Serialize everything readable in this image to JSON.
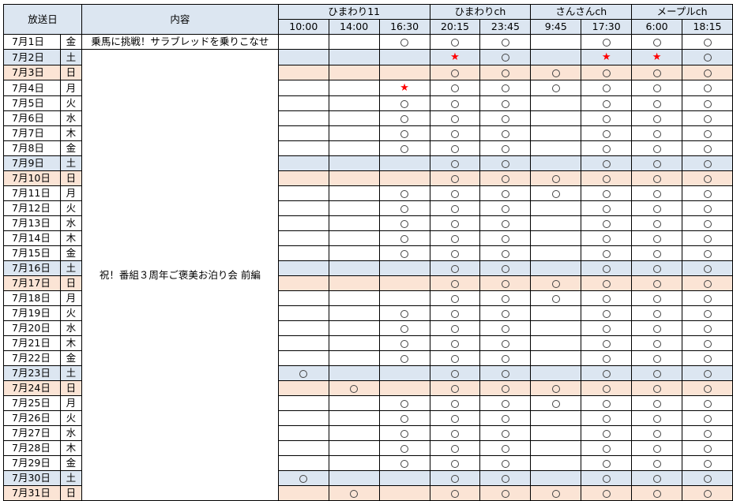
{
  "header": {
    "date_label": "放送日",
    "content_label": "内容",
    "channels": [
      {
        "name": "ひまわり11",
        "span": 3
      },
      {
        "name": "ひまわりch",
        "span": 2
      },
      {
        "name": "さんさんch",
        "span": 2
      },
      {
        "name": "メープルch",
        "span": 2
      }
    ],
    "times": [
      "10:00",
      "14:00",
      "16:30",
      "20:15",
      "23:45",
      "9:45",
      "17:30",
      "6:00",
      "18:15"
    ]
  },
  "contents": [
    {
      "text": "乗馬に挑戦！サラブレッドを乗りこなせ",
      "rows": 1
    },
    {
      "text": "祝！番組３周年ご褒美お泊り会  前編",
      "rows": 30
    }
  ],
  "marks": {
    "circle": "○",
    "star": "★"
  },
  "rows": [
    {
      "date": "7月1日",
      "day": "金",
      "type": "weekday",
      "marks": [
        "",
        "",
        "○",
        "○",
        "○",
        "",
        "○",
        "○",
        "○"
      ]
    },
    {
      "date": "7月2日",
      "day": "土",
      "type": "sat",
      "marks": [
        "",
        "",
        "",
        "★",
        "○",
        "",
        "★",
        "★",
        "○"
      ]
    },
    {
      "date": "7月3日",
      "day": "日",
      "type": "sun",
      "marks": [
        "",
        "",
        "",
        "○",
        "○",
        "○",
        "○",
        "○",
        "○"
      ]
    },
    {
      "date": "7月4日",
      "day": "月",
      "type": "weekday",
      "marks": [
        "",
        "",
        "★",
        "○",
        "○",
        "○",
        "○",
        "○",
        "○"
      ]
    },
    {
      "date": "7月5日",
      "day": "火",
      "type": "weekday",
      "marks": [
        "",
        "",
        "○",
        "○",
        "○",
        "",
        "○",
        "○",
        "○"
      ]
    },
    {
      "date": "7月6日",
      "day": "水",
      "type": "weekday",
      "marks": [
        "",
        "",
        "○",
        "○",
        "○",
        "",
        "○",
        "○",
        "○"
      ]
    },
    {
      "date": "7月7日",
      "day": "木",
      "type": "weekday",
      "marks": [
        "",
        "",
        "○",
        "○",
        "○",
        "",
        "○",
        "○",
        "○"
      ]
    },
    {
      "date": "7月8日",
      "day": "金",
      "type": "weekday",
      "marks": [
        "",
        "",
        "○",
        "○",
        "○",
        "",
        "○",
        "○",
        "○"
      ]
    },
    {
      "date": "7月9日",
      "day": "土",
      "type": "sat",
      "marks": [
        "",
        "",
        "",
        "○",
        "○",
        "",
        "○",
        "○",
        "○"
      ]
    },
    {
      "date": "7月10日",
      "day": "日",
      "type": "sun",
      "marks": [
        "",
        "",
        "",
        "○",
        "○",
        "○",
        "○",
        "○",
        "○"
      ]
    },
    {
      "date": "7月11日",
      "day": "月",
      "type": "weekday",
      "marks": [
        "",
        "",
        "○",
        "○",
        "○",
        "○",
        "○",
        "○",
        "○"
      ]
    },
    {
      "date": "7月12日",
      "day": "火",
      "type": "weekday",
      "marks": [
        "",
        "",
        "○",
        "○",
        "○",
        "",
        "○",
        "○",
        "○"
      ]
    },
    {
      "date": "7月13日",
      "day": "水",
      "type": "weekday",
      "marks": [
        "",
        "",
        "○",
        "○",
        "○",
        "",
        "○",
        "○",
        "○"
      ]
    },
    {
      "date": "7月14日",
      "day": "木",
      "type": "weekday",
      "marks": [
        "",
        "",
        "○",
        "○",
        "○",
        "",
        "○",
        "○",
        "○"
      ]
    },
    {
      "date": "7月15日",
      "day": "金",
      "type": "weekday",
      "marks": [
        "",
        "",
        "○",
        "○",
        "○",
        "",
        "○",
        "○",
        "○"
      ]
    },
    {
      "date": "7月16日",
      "day": "土",
      "type": "sat",
      "marks": [
        "",
        "",
        "",
        "○",
        "○",
        "",
        "○",
        "○",
        "○"
      ]
    },
    {
      "date": "7月17日",
      "day": "日",
      "type": "sun",
      "marks": [
        "",
        "",
        "",
        "○",
        "○",
        "○",
        "○",
        "○",
        "○"
      ]
    },
    {
      "date": "7月18日",
      "day": "月",
      "type": "weekday",
      "marks": [
        "",
        "",
        "",
        "○",
        "○",
        "○",
        "○",
        "○",
        "○"
      ]
    },
    {
      "date": "7月19日",
      "day": "火",
      "type": "weekday",
      "marks": [
        "",
        "",
        "○",
        "○",
        "○",
        "",
        "○",
        "○",
        "○"
      ]
    },
    {
      "date": "7月20日",
      "day": "水",
      "type": "weekday",
      "marks": [
        "",
        "",
        "○",
        "○",
        "○",
        "",
        "○",
        "○",
        "○"
      ]
    },
    {
      "date": "7月21日",
      "day": "木",
      "type": "weekday",
      "marks": [
        "",
        "",
        "○",
        "○",
        "○",
        "",
        "○",
        "○",
        "○"
      ]
    },
    {
      "date": "7月22日",
      "day": "金",
      "type": "weekday",
      "marks": [
        "",
        "",
        "○",
        "○",
        "○",
        "",
        "○",
        "○",
        "○"
      ]
    },
    {
      "date": "7月23日",
      "day": "土",
      "type": "sat",
      "marks": [
        "○",
        "",
        "",
        "○",
        "○",
        "",
        "○",
        "○",
        "○"
      ]
    },
    {
      "date": "7月24日",
      "day": "日",
      "type": "sun",
      "marks": [
        "",
        "○",
        "",
        "○",
        "○",
        "○",
        "○",
        "○",
        "○"
      ]
    },
    {
      "date": "7月25日",
      "day": "月",
      "type": "weekday",
      "marks": [
        "",
        "",
        "○",
        "○",
        "○",
        "○",
        "○",
        "○",
        "○"
      ]
    },
    {
      "date": "7月26日",
      "day": "火",
      "type": "weekday",
      "marks": [
        "",
        "",
        "○",
        "○",
        "○",
        "",
        "○",
        "○",
        "○"
      ]
    },
    {
      "date": "7月27日",
      "day": "水",
      "type": "weekday",
      "marks": [
        "",
        "",
        "○",
        "○",
        "○",
        "",
        "○",
        "○",
        "○"
      ]
    },
    {
      "date": "7月28日",
      "day": "木",
      "type": "weekday",
      "marks": [
        "",
        "",
        "○",
        "○",
        "○",
        "",
        "○",
        "○",
        "○"
      ]
    },
    {
      "date": "7月29日",
      "day": "金",
      "type": "weekday",
      "marks": [
        "",
        "",
        "○",
        "○",
        "○",
        "",
        "○",
        "○",
        "○"
      ]
    },
    {
      "date": "7月30日",
      "day": "土",
      "type": "sat",
      "marks": [
        "○",
        "",
        "",
        "○",
        "○",
        "",
        "○",
        "○",
        "○"
      ]
    },
    {
      "date": "7月31日",
      "day": "日",
      "type": "sun",
      "marks": [
        "",
        "○",
        "",
        "○",
        "○",
        "○",
        "○",
        "○",
        "○"
      ]
    }
  ]
}
